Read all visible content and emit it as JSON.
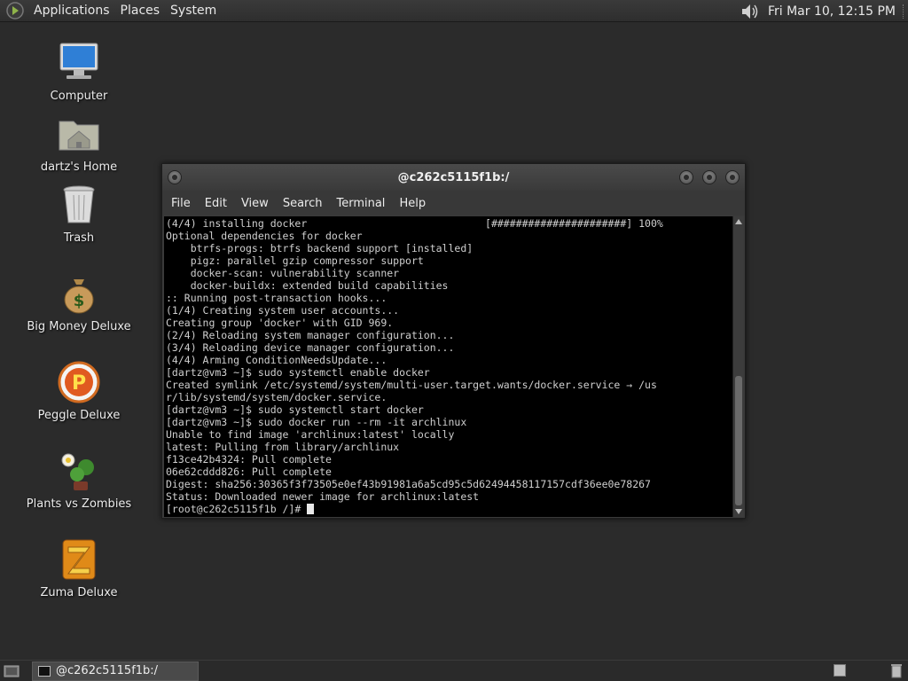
{
  "top_panel": {
    "menus": [
      "Applications",
      "Places",
      "System"
    ],
    "clock": "Fri Mar 10, 12:15 PM",
    "icons": {
      "logo": "gnome-foot-icon",
      "volume": "speaker-icon"
    }
  },
  "desktop": {
    "icons": [
      {
        "label": "Computer",
        "icon": "monitor-icon"
      },
      {
        "label": "dartz's Home",
        "icon": "home-folder-icon"
      },
      {
        "label": "Trash",
        "icon": "trash-icon"
      },
      {
        "label": "Big Money Deluxe",
        "icon": "money-bag-icon"
      },
      {
        "label": "Peggle Deluxe",
        "icon": "peggle-icon"
      },
      {
        "label": "Plants vs Zombies",
        "icon": "plants-icon"
      },
      {
        "label": "Zuma Deluxe",
        "icon": "zuma-icon"
      }
    ]
  },
  "window": {
    "title": "@c262c5115f1b:/",
    "menus": [
      "File",
      "Edit",
      "View",
      "Search",
      "Terminal",
      "Help"
    ],
    "lines": [
      "(4/4) installing docker                             [######################] 100%",
      "Optional dependencies for docker",
      "    btrfs-progs: btrfs backend support [installed]",
      "    pigz: parallel gzip compressor support",
      "    docker-scan: vulnerability scanner",
      "    docker-buildx: extended build capabilities",
      ":: Running post-transaction hooks...",
      "(1/4) Creating system user accounts...",
      "Creating group 'docker' with GID 969.",
      "(2/4) Reloading system manager configuration...",
      "(3/4) Reloading device manager configuration...",
      "(4/4) Arming ConditionNeedsUpdate...",
      "[dartz@vm3 ~]$ sudo systemctl enable docker",
      "Created symlink /etc/systemd/system/multi-user.target.wants/docker.service → /us",
      "r/lib/systemd/system/docker.service.",
      "[dartz@vm3 ~]$ sudo systemctl start docker",
      "[dartz@vm3 ~]$ sudo docker run --rm -it archlinux",
      "Unable to find image 'archlinux:latest' locally",
      "latest: Pulling from library/archlinux",
      "f13ce42b4324: Pull complete",
      "06e62cddd826: Pull complete",
      "Digest: sha256:30365f3f73505e0ef43b91981a6a5cd95c5d62494458117157cdf36ee0e78267",
      "Status: Downloaded newer image for archlinux:latest"
    ],
    "prompt": "[root@c262c5115f1b /]# "
  },
  "bottom_panel": {
    "task_label": "@c262c5115f1b:/"
  },
  "colors": {
    "desktop_bg": "#2b2b2b",
    "terminal_bg": "#000000",
    "terminal_fg": "#cfcfcf"
  }
}
